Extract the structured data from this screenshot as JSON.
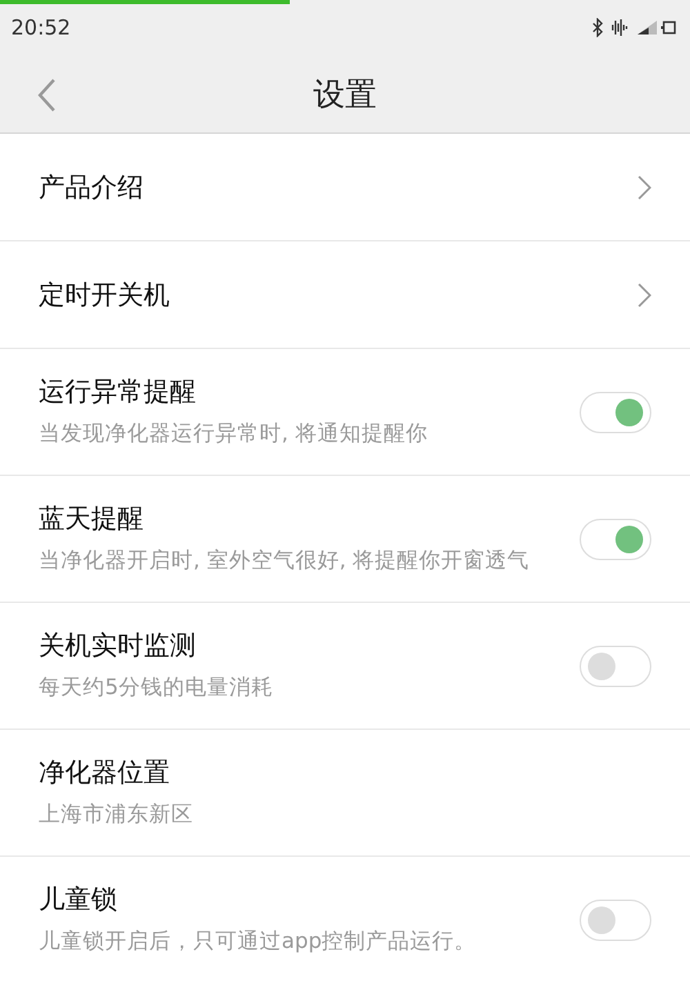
{
  "status_bar": {
    "time": "20:52",
    "load_progress": {
      "level": 0.42
    }
  },
  "header": {
    "title": "设置"
  },
  "items": [
    {
      "kind": "link",
      "title": "产品介绍"
    },
    {
      "kind": "link",
      "title": "定时开关机"
    },
    {
      "kind": "toggle",
      "title": "运行异常提醒",
      "subtitle": "当发现净化器运行异常时, 将通知提醒你",
      "on": true
    },
    {
      "kind": "toggle",
      "title": "蓝天提醒",
      "subtitle": "当净化器开启时, 室外空气很好, 将提醒你开窗透气",
      "on": true
    },
    {
      "kind": "toggle",
      "title": "关机实时监测",
      "subtitle": "每天约5分钱的电量消耗",
      "on": false
    },
    {
      "kind": "info",
      "title": "净化器位置",
      "subtitle": "上海市浦东新区"
    },
    {
      "kind": "toggle",
      "title": "儿童锁",
      "subtitle": "儿童锁开启后，只可通过app控制产品运行。",
      "on": false
    }
  ]
}
